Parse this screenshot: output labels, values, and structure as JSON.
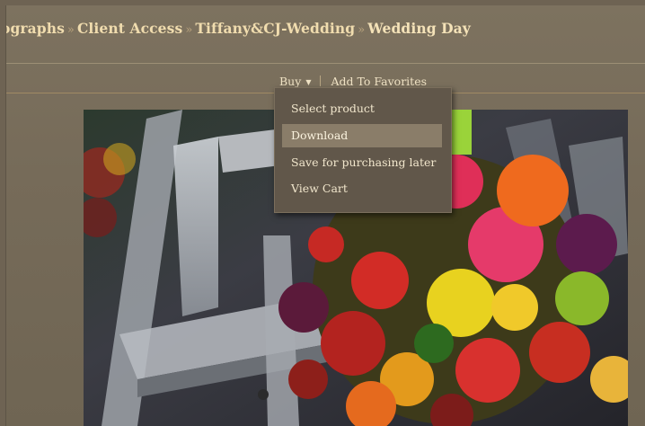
{
  "breadcrumb": {
    "items": [
      "ographs",
      "Client Access",
      "Tiffany&CJ-Wedding"
    ],
    "current": "Wedding Day",
    "separator": "»"
  },
  "actions": {
    "buy_label": "Buy",
    "favorites_label": "Add To Favorites"
  },
  "buy_menu": {
    "options": [
      "Select product",
      "Download",
      "Save for purchasing later",
      "View Cart"
    ],
    "highlighted_index": 1
  },
  "colors": {
    "background": "#766b59",
    "breadcrumb_text": "#f0dcae",
    "menu_background": "#61574a",
    "menu_highlight": "#8a7d69"
  },
  "photo": {
    "subject": "wedding bouquet"
  }
}
